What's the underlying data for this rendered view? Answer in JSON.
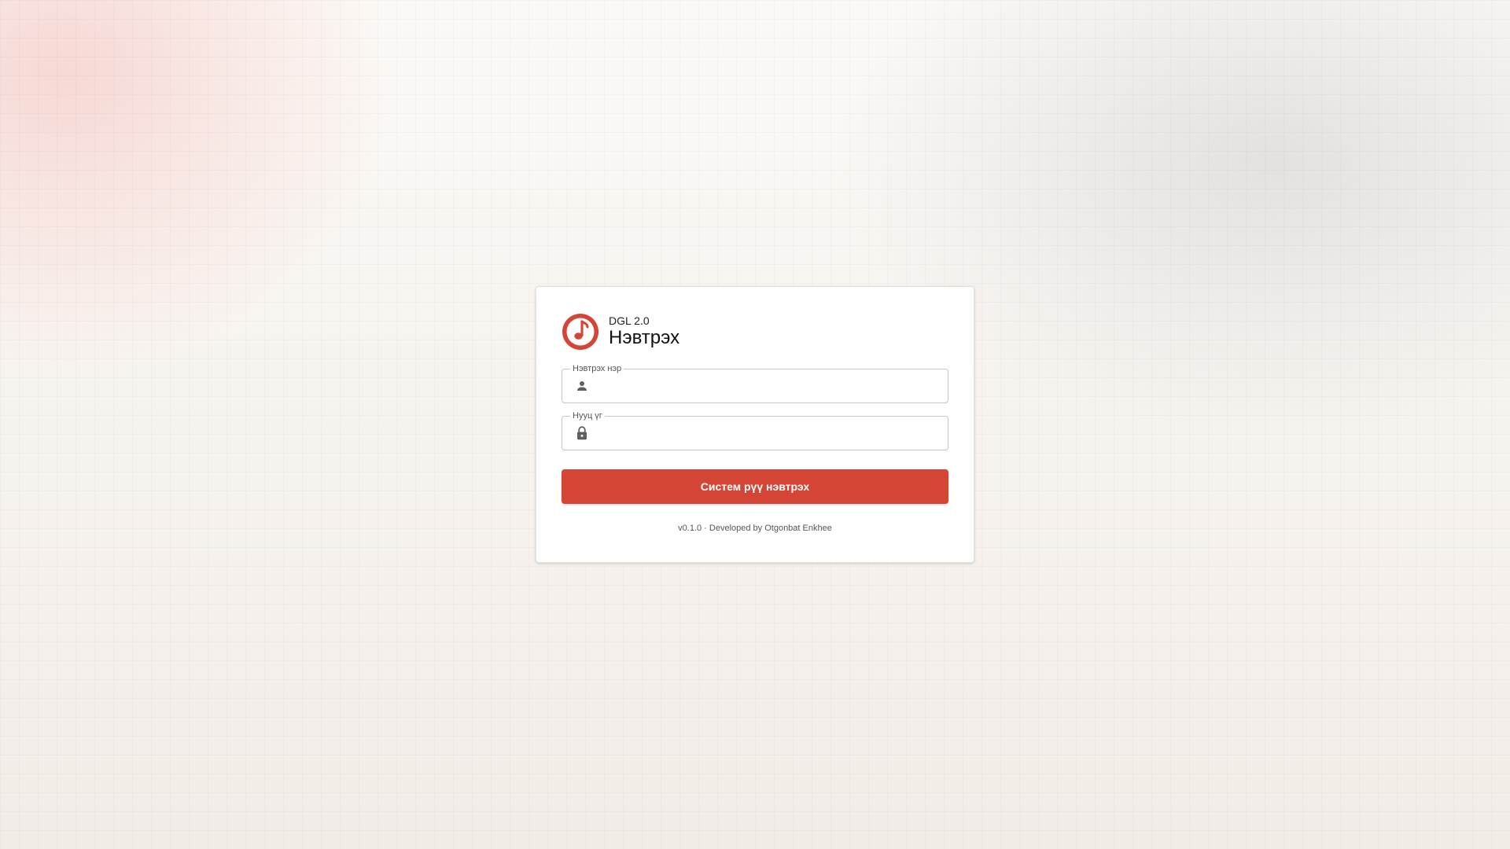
{
  "brand": {
    "subtitle": "DGL 2.0",
    "title": "Нэвтрэх",
    "logo_icon": "music-note-icon",
    "accent_color": "#d54535"
  },
  "form": {
    "username": {
      "label": "Нэвтрэх нэр",
      "value": "",
      "icon": "person-icon"
    },
    "password": {
      "label": "Нууц үг",
      "value": "",
      "icon": "lock-icon"
    },
    "submit_label": "Систем рүү нэвтрэх"
  },
  "footer": {
    "text": "v0.1.0 · Developed by Otgonbat Enkhee"
  }
}
